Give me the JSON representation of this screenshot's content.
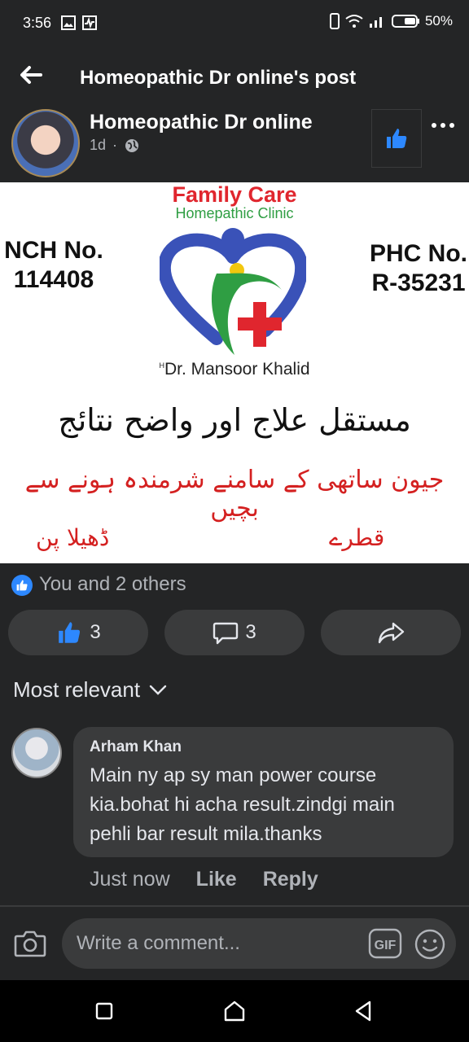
{
  "status": {
    "time": "3:56",
    "battery": "50%"
  },
  "topbar": {
    "title": "Homeopathic Dr online's post"
  },
  "post": {
    "page_name": "Homeopathic Dr online",
    "age": "1d",
    "separator": "·",
    "image": {
      "heading": "Family Care",
      "subheading": "Homepathic Clinic",
      "left_label_line1": "NCH No.",
      "left_label_line2": "114408",
      "right_label_line1": "PHC No.",
      "right_label_line2": "R-35231",
      "doctor_prefix": "H",
      "doctor": "Dr. Mansoor Khalid",
      "urdu_line1": "مستقل علاج اور واضح نتائج",
      "urdu_line2": "جیون ساتھی کے سامنے شرمندہ ہونے سے بچیں",
      "urdu_left": "ڈھیلا پن",
      "urdu_right": "قطرے"
    },
    "reactions_text": "You and 2 others",
    "like_count": "3",
    "comment_count": "3"
  },
  "comments": {
    "sort_label": "Most relevant",
    "items": [
      {
        "author": "Arham Khan",
        "text": "Main ny ap sy man power course kia.bohat hi acha result.zindgi main pehli bar result mila.thanks",
        "time": "Just now",
        "like_label": "Like",
        "reply_label": "Reply"
      }
    ]
  },
  "composer": {
    "placeholder": "Write a comment..."
  },
  "colors": {
    "background": "#242526",
    "surface": "#3a3b3c",
    "accent": "#2d88ff",
    "text": "#e4e6eb",
    "muted": "#b0b3b8"
  }
}
